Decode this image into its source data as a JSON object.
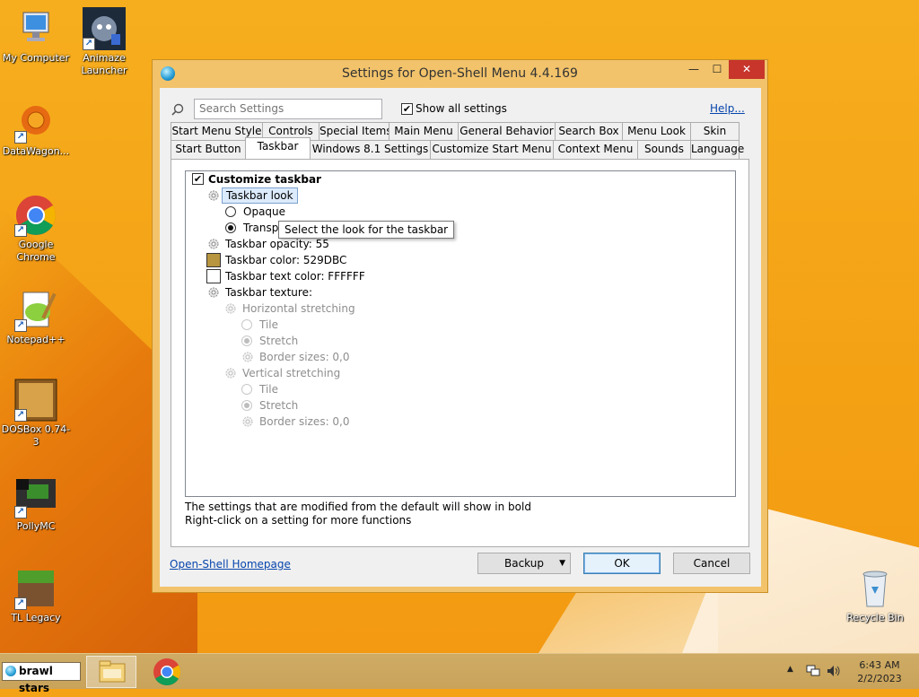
{
  "desktop": {
    "icons": [
      {
        "label": "My Computer"
      },
      {
        "label": "Animaze Launcher"
      },
      {
        "label": "DataWagon..."
      },
      {
        "label": "Google Chrome"
      },
      {
        "label": "Notepad++"
      },
      {
        "label": "DOSBox 0.74-3"
      },
      {
        "label": "PollyMC"
      },
      {
        "label": "TL Legacy"
      },
      {
        "label": "Recycle Bin"
      }
    ]
  },
  "window": {
    "title": "Settings for Open-Shell Menu 4.4.169",
    "minimize_glyph": "—",
    "maximize_glyph": "☐",
    "close_glyph": "✕",
    "search": {
      "placeholder": "Search Settings",
      "value": ""
    },
    "show_all": {
      "label": "Show all settings",
      "checked": true,
      "mark": "✔"
    },
    "help_label": "Help...",
    "tabs_row1": [
      "Start Menu Style",
      "Controls",
      "Special Items",
      "Main Menu",
      "General Behavior",
      "Search Box",
      "Menu Look",
      "Skin"
    ],
    "tabs_row2": [
      "Start Button",
      "Taskbar",
      "Windows 8.1 Settings",
      "Customize Start Menu",
      "Context Menu",
      "Sounds",
      "Language"
    ],
    "active_tab": "Taskbar",
    "tree": {
      "customize": {
        "label": "Customize taskbar",
        "checked": true,
        "mark": "✔"
      },
      "taskbar_look": "Taskbar look",
      "opaque": "Opaque",
      "transparent": "Transp",
      "opacity": "Taskbar opacity: 55",
      "color": "Taskbar color: 529DBC",
      "color_swatch": "#b8953f",
      "text_color": "Taskbar text color: FFFFFF",
      "text_color_swatch": "#ffffff",
      "texture": "Taskbar texture:",
      "horizontal": "Horizontal stretching",
      "h_tile": "Tile",
      "h_stretch": "Stretch",
      "h_border": "Border sizes: 0,0",
      "vertical": "Vertical stretching",
      "v_tile": "Tile",
      "v_stretch": "Stretch",
      "v_border": "Border sizes: 0,0"
    },
    "tooltip": "Select the look for the taskbar",
    "info_line1": "The settings that are modified from the default will show in bold",
    "info_line2": "Right-click on a setting for more functions",
    "homepage_link": "Open-Shell Homepage",
    "buttons": {
      "backup": "Backup",
      "ok": "OK",
      "cancel": "Cancel",
      "dropdown_glyph": "▼"
    }
  },
  "taskbar": {
    "search_text": "brawl stars",
    "tray_arrow": "▲",
    "clock_time": "6:43 AM",
    "clock_date": "2/2/2023"
  },
  "colors": {
    "accent_close": "#c7352b",
    "desktop_orange": "#f4a114",
    "link": "#0645ad"
  }
}
